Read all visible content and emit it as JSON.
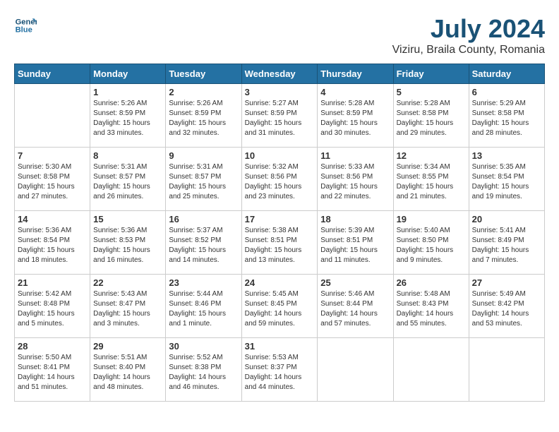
{
  "logo": {
    "line1": "General",
    "line2": "Blue"
  },
  "title": "July 2024",
  "location": "Viziru, Braila County, Romania",
  "weekdays": [
    "Sunday",
    "Monday",
    "Tuesday",
    "Wednesday",
    "Thursday",
    "Friday",
    "Saturday"
  ],
  "weeks": [
    [
      {
        "day": "",
        "sunrise": "",
        "sunset": "",
        "daylight": ""
      },
      {
        "day": "1",
        "sunrise": "Sunrise: 5:26 AM",
        "sunset": "Sunset: 8:59 PM",
        "daylight": "Daylight: 15 hours and 33 minutes."
      },
      {
        "day": "2",
        "sunrise": "Sunrise: 5:26 AM",
        "sunset": "Sunset: 8:59 PM",
        "daylight": "Daylight: 15 hours and 32 minutes."
      },
      {
        "day": "3",
        "sunrise": "Sunrise: 5:27 AM",
        "sunset": "Sunset: 8:59 PM",
        "daylight": "Daylight: 15 hours and 31 minutes."
      },
      {
        "day": "4",
        "sunrise": "Sunrise: 5:28 AM",
        "sunset": "Sunset: 8:59 PM",
        "daylight": "Daylight: 15 hours and 30 minutes."
      },
      {
        "day": "5",
        "sunrise": "Sunrise: 5:28 AM",
        "sunset": "Sunset: 8:58 PM",
        "daylight": "Daylight: 15 hours and 29 minutes."
      },
      {
        "day": "6",
        "sunrise": "Sunrise: 5:29 AM",
        "sunset": "Sunset: 8:58 PM",
        "daylight": "Daylight: 15 hours and 28 minutes."
      }
    ],
    [
      {
        "day": "7",
        "sunrise": "Sunrise: 5:30 AM",
        "sunset": "Sunset: 8:58 PM",
        "daylight": "Daylight: 15 hours and 27 minutes."
      },
      {
        "day": "8",
        "sunrise": "Sunrise: 5:31 AM",
        "sunset": "Sunset: 8:57 PM",
        "daylight": "Daylight: 15 hours and 26 minutes."
      },
      {
        "day": "9",
        "sunrise": "Sunrise: 5:31 AM",
        "sunset": "Sunset: 8:57 PM",
        "daylight": "Daylight: 15 hours and 25 minutes."
      },
      {
        "day": "10",
        "sunrise": "Sunrise: 5:32 AM",
        "sunset": "Sunset: 8:56 PM",
        "daylight": "Daylight: 15 hours and 23 minutes."
      },
      {
        "day": "11",
        "sunrise": "Sunrise: 5:33 AM",
        "sunset": "Sunset: 8:56 PM",
        "daylight": "Daylight: 15 hours and 22 minutes."
      },
      {
        "day": "12",
        "sunrise": "Sunrise: 5:34 AM",
        "sunset": "Sunset: 8:55 PM",
        "daylight": "Daylight: 15 hours and 21 minutes."
      },
      {
        "day": "13",
        "sunrise": "Sunrise: 5:35 AM",
        "sunset": "Sunset: 8:54 PM",
        "daylight": "Daylight: 15 hours and 19 minutes."
      }
    ],
    [
      {
        "day": "14",
        "sunrise": "Sunrise: 5:36 AM",
        "sunset": "Sunset: 8:54 PM",
        "daylight": "Daylight: 15 hours and 18 minutes."
      },
      {
        "day": "15",
        "sunrise": "Sunrise: 5:36 AM",
        "sunset": "Sunset: 8:53 PM",
        "daylight": "Daylight: 15 hours and 16 minutes."
      },
      {
        "day": "16",
        "sunrise": "Sunrise: 5:37 AM",
        "sunset": "Sunset: 8:52 PM",
        "daylight": "Daylight: 15 hours and 14 minutes."
      },
      {
        "day": "17",
        "sunrise": "Sunrise: 5:38 AM",
        "sunset": "Sunset: 8:51 PM",
        "daylight": "Daylight: 15 hours and 13 minutes."
      },
      {
        "day": "18",
        "sunrise": "Sunrise: 5:39 AM",
        "sunset": "Sunset: 8:51 PM",
        "daylight": "Daylight: 15 hours and 11 minutes."
      },
      {
        "day": "19",
        "sunrise": "Sunrise: 5:40 AM",
        "sunset": "Sunset: 8:50 PM",
        "daylight": "Daylight: 15 hours and 9 minutes."
      },
      {
        "day": "20",
        "sunrise": "Sunrise: 5:41 AM",
        "sunset": "Sunset: 8:49 PM",
        "daylight": "Daylight: 15 hours and 7 minutes."
      }
    ],
    [
      {
        "day": "21",
        "sunrise": "Sunrise: 5:42 AM",
        "sunset": "Sunset: 8:48 PM",
        "daylight": "Daylight: 15 hours and 5 minutes."
      },
      {
        "day": "22",
        "sunrise": "Sunrise: 5:43 AM",
        "sunset": "Sunset: 8:47 PM",
        "daylight": "Daylight: 15 hours and 3 minutes."
      },
      {
        "day": "23",
        "sunrise": "Sunrise: 5:44 AM",
        "sunset": "Sunset: 8:46 PM",
        "daylight": "Daylight: 15 hours and 1 minute."
      },
      {
        "day": "24",
        "sunrise": "Sunrise: 5:45 AM",
        "sunset": "Sunset: 8:45 PM",
        "daylight": "Daylight: 14 hours and 59 minutes."
      },
      {
        "day": "25",
        "sunrise": "Sunrise: 5:46 AM",
        "sunset": "Sunset: 8:44 PM",
        "daylight": "Daylight: 14 hours and 57 minutes."
      },
      {
        "day": "26",
        "sunrise": "Sunrise: 5:48 AM",
        "sunset": "Sunset: 8:43 PM",
        "daylight": "Daylight: 14 hours and 55 minutes."
      },
      {
        "day": "27",
        "sunrise": "Sunrise: 5:49 AM",
        "sunset": "Sunset: 8:42 PM",
        "daylight": "Daylight: 14 hours and 53 minutes."
      }
    ],
    [
      {
        "day": "28",
        "sunrise": "Sunrise: 5:50 AM",
        "sunset": "Sunset: 8:41 PM",
        "daylight": "Daylight: 14 hours and 51 minutes."
      },
      {
        "day": "29",
        "sunrise": "Sunrise: 5:51 AM",
        "sunset": "Sunset: 8:40 PM",
        "daylight": "Daylight: 14 hours and 48 minutes."
      },
      {
        "day": "30",
        "sunrise": "Sunrise: 5:52 AM",
        "sunset": "Sunset: 8:38 PM",
        "daylight": "Daylight: 14 hours and 46 minutes."
      },
      {
        "day": "31",
        "sunrise": "Sunrise: 5:53 AM",
        "sunset": "Sunset: 8:37 PM",
        "daylight": "Daylight: 14 hours and 44 minutes."
      },
      {
        "day": "",
        "sunrise": "",
        "sunset": "",
        "daylight": ""
      },
      {
        "day": "",
        "sunrise": "",
        "sunset": "",
        "daylight": ""
      },
      {
        "day": "",
        "sunrise": "",
        "sunset": "",
        "daylight": ""
      }
    ]
  ]
}
